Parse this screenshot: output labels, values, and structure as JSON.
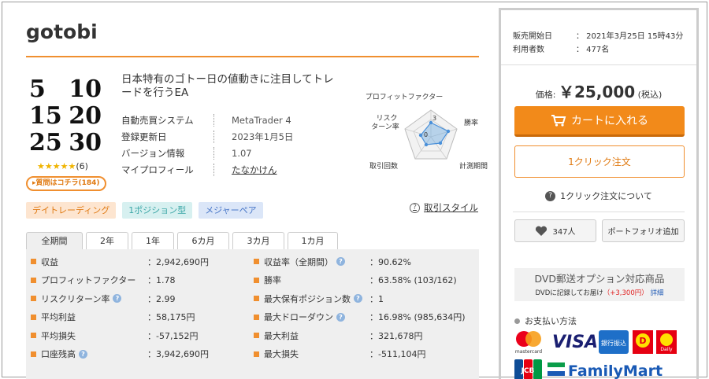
{
  "product": {
    "title": "gotobi",
    "logo_numbers": [
      [
        "5",
        "10"
      ],
      [
        "15",
        "20"
      ],
      [
        "25",
        "30"
      ]
    ],
    "stars": "★★★★★",
    "review_count": "(6)",
    "question_button": "▸質問はコチラ(184)",
    "description": "日本特有のゴトー日の値動きに注目してトレードを行うEA",
    "info": [
      {
        "key": "自動売買システム",
        "value": "MetaTrader 4"
      },
      {
        "key": "登録更新日",
        "value": "2023年1月5日"
      },
      {
        "key": "バージョン情報",
        "value": "1.07"
      },
      {
        "key": "マイプロフィール",
        "value": "たなかけん"
      }
    ],
    "radar": {
      "labels": [
        "プロフィットファクター",
        "勝率",
        "計測期間",
        "取引回数",
        "リスク",
        "ターン率"
      ],
      "center_label": "0",
      "top_label": "3"
    },
    "tags": [
      "デイトレーディング",
      "1ポジション型",
      "メジャーペア"
    ],
    "trade_style_link": "取引スタイル"
  },
  "period_tabs": [
    "全期間",
    "2年",
    "1年",
    "6カ月",
    "3カ月",
    "1カ月"
  ],
  "stats_left": [
    {
      "label": "収益",
      "value": "：2,942,690円",
      "help": false
    },
    {
      "label": "プロフィットファクター",
      "value": "：1.78",
      "help": false
    },
    {
      "label": "リスクリターン率",
      "value": "：2.99",
      "help": true
    },
    {
      "label": "平均利益",
      "value": "：58,175円",
      "help": false
    },
    {
      "label": "平均損失",
      "value": "：-57,152円",
      "help": false
    },
    {
      "label": "口座残高",
      "value": "：3,942,690円",
      "help": true
    }
  ],
  "stats_right": [
    {
      "label": "収益率（全期間）",
      "value": "：90.62%",
      "help": true
    },
    {
      "label": "勝率",
      "value": "：63.58% (103/162)",
      "help": false
    },
    {
      "label": "最大保有ポジション数",
      "value": "：1",
      "help": true
    },
    {
      "label": "最大ドローダウン",
      "value": "：16.98% (985,634円)",
      "help": true
    },
    {
      "label": "最大利益",
      "value": "：321,678円",
      "help": false
    },
    {
      "label": "最大損失",
      "value": "：-511,104円",
      "help": false
    }
  ],
  "side": {
    "sale_start_label": "販売開始日",
    "sale_start_value": "：  2021年3月25日 15時43分",
    "users_label": "利用者数",
    "users_value": "：  477名",
    "price_label": "価格:",
    "price_value": "￥25,000",
    "price_tax": "(税込)",
    "cart_button": "カートに入れる",
    "one_click_button": "1クリック注文",
    "about_one_click": "1クリック注文について",
    "like_count": "347人",
    "portfolio_button": "ポートフォリオ追加",
    "dvd_title": "DVD郵送オプション対応商品",
    "dvd_text": "DVDに記録してお届け",
    "dvd_price": "（+3,300円）",
    "dvd_detail": "詳細",
    "payment_title": "お支払い方法",
    "payment_logos": {
      "mastercard": "mastercard",
      "visa": "VISA",
      "bank": "銀行振込",
      "daily": "Daily",
      "jcb": "JCB",
      "familymart": "FamilyMart"
    }
  },
  "colors": {
    "accent": "#f08f2f",
    "cart": "#f28a1a",
    "stats_bg": "#efefef"
  }
}
